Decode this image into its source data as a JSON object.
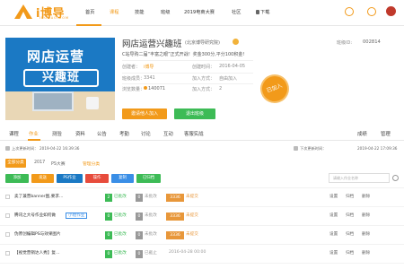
{
  "brand": {
    "logo_text": "i博导",
    "logo_sub": "IBODAO.COM"
  },
  "nav": {
    "items": [
      "首页",
      "课程",
      "技能",
      "班级",
      "2019电商大赛",
      "社区",
      "下载"
    ],
    "active_index": 1
  },
  "course": {
    "banner_line1": "网店运营",
    "banner_line2": "兴趣班",
    "title": "网店运营兴趣班",
    "org": "(北京博导研究院)",
    "class_no_label": "班级ID:",
    "class_no": "002814",
    "slogan": "C站导购二届“丰富之眼”正式开战！奖金300分,平分100积金!",
    "creator_label": "创建者：",
    "creator": "i博导",
    "created_label": "创建时间：",
    "created": "2016-04-05",
    "members_label": "班级成员：",
    "members": "3341",
    "join_label": "加入方式：",
    "join": "自由加入",
    "views_label": "浏览数量：",
    "views": "140071",
    "teachers_label": "加入方式：",
    "teachers": "2",
    "seal_text": "已加入",
    "invite_button": "邀请他人加入",
    "quit_button": "退出班级"
  },
  "tabs": {
    "items": [
      "课程",
      "作业",
      "测验",
      "资料",
      "公告",
      "考勤",
      "讨论",
      "互动",
      "客服实战"
    ],
    "active_index": 1,
    "right": [
      "成绩",
      "管理"
    ]
  },
  "updates": {
    "left": "上次更新时间：",
    "left_time": "2019-04-22 16:39:36",
    "right": "下次更新时间：",
    "right_time": "2019-04-22 17:09:36"
  },
  "filters": {
    "all": "全部分类",
    "f1": "2017",
    "f2": "PS大赛",
    "manage": "管理分类"
  },
  "actions": {
    "b1": "添加",
    "b2": "发送",
    "b3": "PS作业",
    "b4": "操作",
    "b5": "复制",
    "b6": "已归档",
    "search_placeholder": "请输入作业名称"
  },
  "rows": [
    {
      "name": "卖了兼营banner图,要求…",
      "tag": "",
      "done": "2",
      "done_label": "已批改",
      "pending": "0",
      "pending_label": "未批改",
      "total": "3336",
      "total_label": "未提交",
      "ops": [
        "设置",
        "归档",
        "删除"
      ]
    },
    {
      "name": "腾讯之大号作业如何做",
      "tag": "小组作业",
      "done": "0",
      "done_label": "已批改",
      "pending": "0",
      "pending_label": "未批改",
      "total": "3336",
      "total_label": "未提交",
      "ops": [
        "设置",
        "归档",
        "删除"
      ]
    },
    {
      "name": "伪原创编辑PS与效果图片",
      "tag": "",
      "done": "0",
      "done_label": "已批改",
      "pending": "0",
      "pending_label": "未批改",
      "total": "3336",
      "total_label": "未提交",
      "ops": [
        "设置",
        "归档",
        "删除"
      ]
    },
    {
      "name": "【视觉营销达人秀】复…",
      "tag": "",
      "done": "0",
      "done_label": "已批改",
      "pending": "0",
      "pending_label": "已截止",
      "total": "",
      "total_label": "2016-04-28 00:00",
      "ops": [
        "设置",
        "归档",
        "删除"
      ]
    },
    {
      "name": "",
      "tag": "",
      "done": "0",
      "done_label": "已批改",
      "pending": "0",
      "pending_label": "未批改",
      "total": "",
      "total_label": "",
      "ops": [
        "设置",
        "归档",
        "删除"
      ]
    }
  ],
  "colors": {
    "accent": "#f29a1a",
    "green": "#3dbb56",
    "blue": "#1b79c4"
  }
}
